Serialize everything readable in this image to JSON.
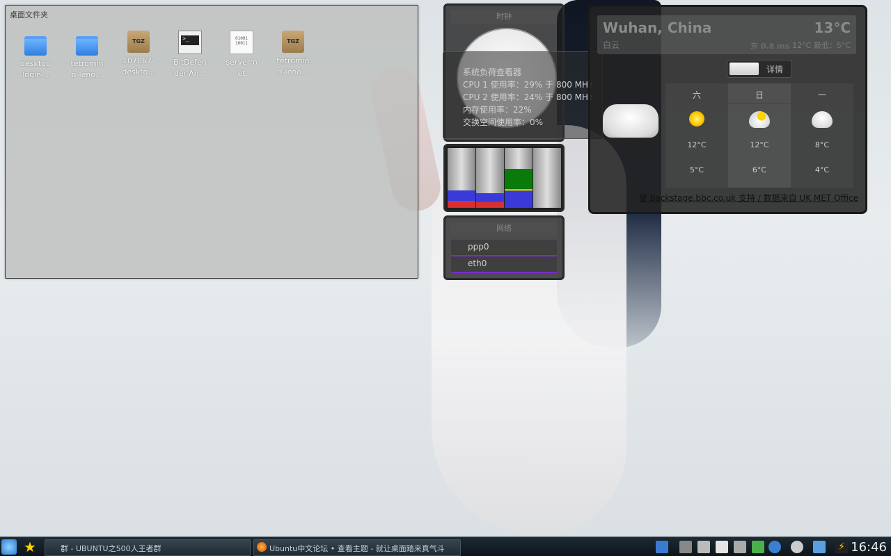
{
  "folder_view": {
    "title": "桌面文件夹",
    "files": [
      {
        "label1": "desktop",
        "label2": "-login-...",
        "icon": "folder-icon"
      },
      {
        "label1": "tetromin",
        "label2": "o-leno...",
        "icon": "folder-icon"
      },
      {
        "label1": "107067-",
        "label2": "deskto...",
        "icon": "tgz-archive-icon",
        "badge": "TGZ"
      },
      {
        "label1": "BitDefen",
        "label2": "der-An...",
        "icon": "terminal-script-icon",
        "badge": ">_"
      },
      {
        "label1": "serverm",
        "label2": "et",
        "icon": "binary-file-icon",
        "badge": "01001\n10011"
      },
      {
        "label1": "tetromin",
        "label2": "o-leno...",
        "icon": "tgz-archive-icon",
        "badge": "TGZ"
      }
    ]
  },
  "clock_widget": {
    "title": "时钟"
  },
  "system_load_tooltip": {
    "title": "系统负荷查看器",
    "lines": [
      "CPU 1 使用率：29% 于 800 MHz",
      "CPU 2 使用率：24% 于 800 MHz",
      "内存使用率：22%",
      "交换空间使用率：0%"
    ]
  },
  "load_bars": [
    {
      "name": "cpu1",
      "fraction": 0.29
    },
    {
      "name": "cpu2",
      "fraction": 0.24
    },
    {
      "name": "memory",
      "fraction": 0.65
    },
    {
      "name": "swap",
      "fraction": 0.0
    }
  ],
  "network_widget": {
    "title": "网络",
    "interfaces": [
      "ppp0",
      "eth0"
    ]
  },
  "weather": {
    "city": "Wuhan, China",
    "temp": "13°C",
    "condition": "白云",
    "wind": "东 0.8 ms",
    "range": "12°C 最低：5°C",
    "toggle_label": "详情",
    "forecast": [
      {
        "day": "六",
        "icon": "sunny-icon",
        "high": "12°C",
        "low": "5°C"
      },
      {
        "day": "日",
        "icon": "partly-cloudy-icon",
        "high": "12°C",
        "low": "6°C"
      },
      {
        "day": "一",
        "icon": "cloudy-icon",
        "high": "8°C",
        "low": "4°C"
      }
    ],
    "credit": "受 backstage.bbc.co.uk 支持 / 数据来自 UK MET Office"
  },
  "taskbar": {
    "tasks": [
      "群 - UBUNTU之500人王者群",
      "Ubuntu中文论坛 • 查看主题 - 就让桌面踏来真气斗"
    ],
    "clock": "16:46"
  }
}
